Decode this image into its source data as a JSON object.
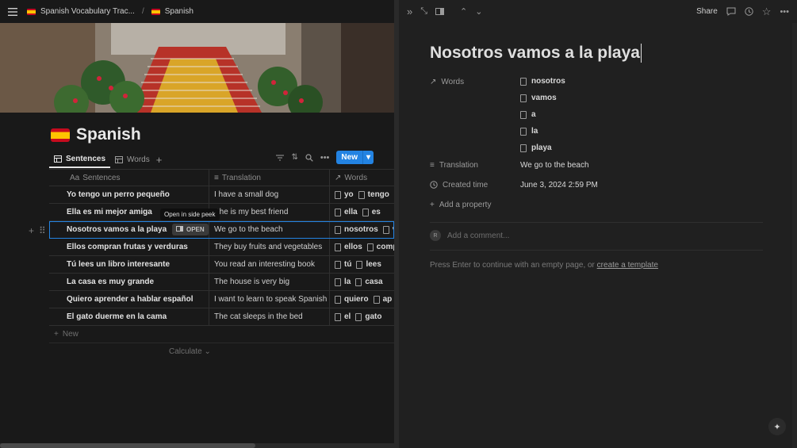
{
  "breadcrumb": {
    "workspace": "Spanish Vocabulary Trac...",
    "separator": "/",
    "page": "Spanish"
  },
  "page": {
    "title": "Spanish"
  },
  "views": {
    "tabs": [
      {
        "label": "Sentences",
        "active": true
      },
      {
        "label": "Words",
        "active": false
      }
    ],
    "new_label": "New"
  },
  "table": {
    "columns": [
      "Sentences",
      "Translation",
      "Words"
    ],
    "column_prefix": "Aa",
    "rows": [
      {
        "sentence": "Yo tengo un perro pequeño",
        "translation": "I have a small dog",
        "words": [
          "yo",
          "tengo"
        ]
      },
      {
        "sentence": "Ella es mi mejor amiga",
        "translation": "She is my best friend",
        "words": [
          "ella",
          "es"
        ]
      },
      {
        "sentence": "Nosotros vamos a la playa",
        "translation": "We go to the beach",
        "words": [
          "nosotros",
          "v"
        ]
      },
      {
        "sentence": "Ellos compran frutas y verduras",
        "translation": "They buy fruits and vegetables",
        "words": [
          "ellos",
          "comp"
        ]
      },
      {
        "sentence": "Tú lees un libro interesante",
        "translation": "You read an interesting book",
        "words": [
          "tú",
          "lees"
        ]
      },
      {
        "sentence": "La casa es muy grande",
        "translation": "The house is very big",
        "words": [
          "la",
          "casa"
        ]
      },
      {
        "sentence": "Quiero aprender a hablar español",
        "translation": "I want to learn to speak Spanish",
        "words": [
          "quiero",
          "ap"
        ]
      },
      {
        "sentence": "El gato duerme en la cama",
        "translation": "The cat sleeps in the bed",
        "words": [
          "el",
          "gato"
        ]
      }
    ],
    "selected_row_index": 2,
    "open_label": "OPEN",
    "tooltip": "Open in side peek",
    "new_row_label": "New",
    "calculate_label": "Calculate"
  },
  "peek": {
    "title": "Nosotros vamos a la playa",
    "share_label": "Share",
    "properties": {
      "words_label": "Words",
      "words": [
        "nosotros",
        "vamos",
        "a",
        "la",
        "playa"
      ],
      "translation_label": "Translation",
      "translation": "We go to the beach",
      "created_label": "Created time",
      "created": "June 3, 2024 2:59 PM",
      "add_property": "Add a property"
    },
    "comment_placeholder": "Add a comment...",
    "avatar_initial": "R",
    "empty_hint": "Press Enter to continue with an empty page, or",
    "template_link": "create a template"
  }
}
